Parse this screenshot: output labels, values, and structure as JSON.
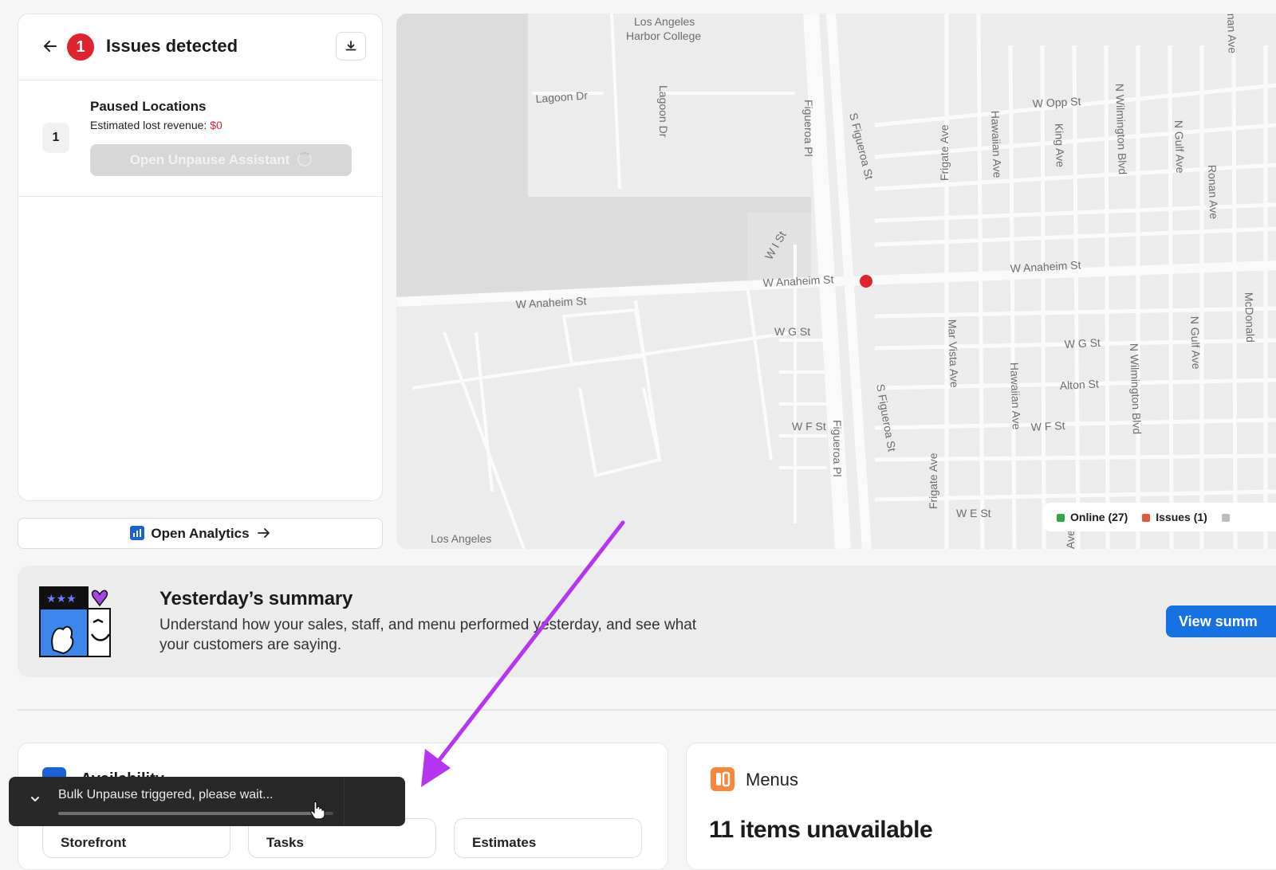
{
  "issues": {
    "count": "1",
    "title": "Issues detected",
    "paused": {
      "count": "1",
      "title": "Paused Locations",
      "lost_revenue_label": "Estimated lost revenue: ",
      "lost_revenue_value": "$0",
      "button_label": "Open Unpause Assistant"
    }
  },
  "analytics": {
    "label": "Open Analytics"
  },
  "map": {
    "labels": {
      "college": "Los Angeles",
      "college2": "Harbor College",
      "lagoon_dr": "Lagoon Dr",
      "lagoon_dr_v": "Lagoon Dr",
      "w_anaheim_1": "W Anaheim St",
      "w_anaheim_2": "W Anaheim St",
      "w_anaheim_3": "W Anaheim St",
      "w_i_st": "W I St",
      "w_g_st_1": "W G St",
      "w_g_st_2": "W G St",
      "w_f_st_1": "W F St",
      "w_f_st_2": "W F St",
      "w_e_st": "W E St",
      "w_opp_st": "W Opp St",
      "alton_st": "Alton St",
      "figueroa_pl_1": "Figueroa Pl",
      "figueroa_pl_2": "Figueroa Pl",
      "s_figueroa_1": "S Figueroa St",
      "s_figueroa_2": "S Figueroa St",
      "frigate_1": "Frigate Ave",
      "frigate_2": "Frigate Ave",
      "hawaiian_1": "Hawaiian Ave",
      "hawaiian_2": "Hawaiian Ave",
      "king_ave": "King Ave",
      "wilmington_1": "N Wilmington Blvd",
      "wilmington_2": "N Wilmington Blvd",
      "gulf_1": "N Gulf Ave",
      "gulf_2": "N Gulf Ave",
      "ronan": "Ronan Ave",
      "nan_ave": "nan Ave",
      "mar_vista": "Mar Vista Ave",
      "los_angeles_bottom": "Los Angeles",
      "ave_bottom": "Ave",
      "mcdonald": "McDonald"
    },
    "legend": {
      "online": "Online (27)",
      "issues": "Issues (1)",
      "online_color": "#2ea84a",
      "issues_color": "#e2583b",
      "other_color": "#bdbdbd"
    }
  },
  "summary": {
    "title": "Yesterday’s summary",
    "description": "Understand how your sales, staff, and menu performed yesterday, and see what your customers are saying.",
    "button_label": "View summ"
  },
  "availability": {
    "title": "Availability",
    "tabs": [
      "Storefront",
      "Tasks",
      "Estimates"
    ]
  },
  "menus": {
    "title": "Menus",
    "metric": "11 items unavailable"
  },
  "toast": {
    "message": "Bulk Unpause triggered, please wait...",
    "progress": 0.93
  },
  "colors": {
    "accent": "#1672e3",
    "alert": "#e0232e",
    "annotation": "#b535f0"
  }
}
